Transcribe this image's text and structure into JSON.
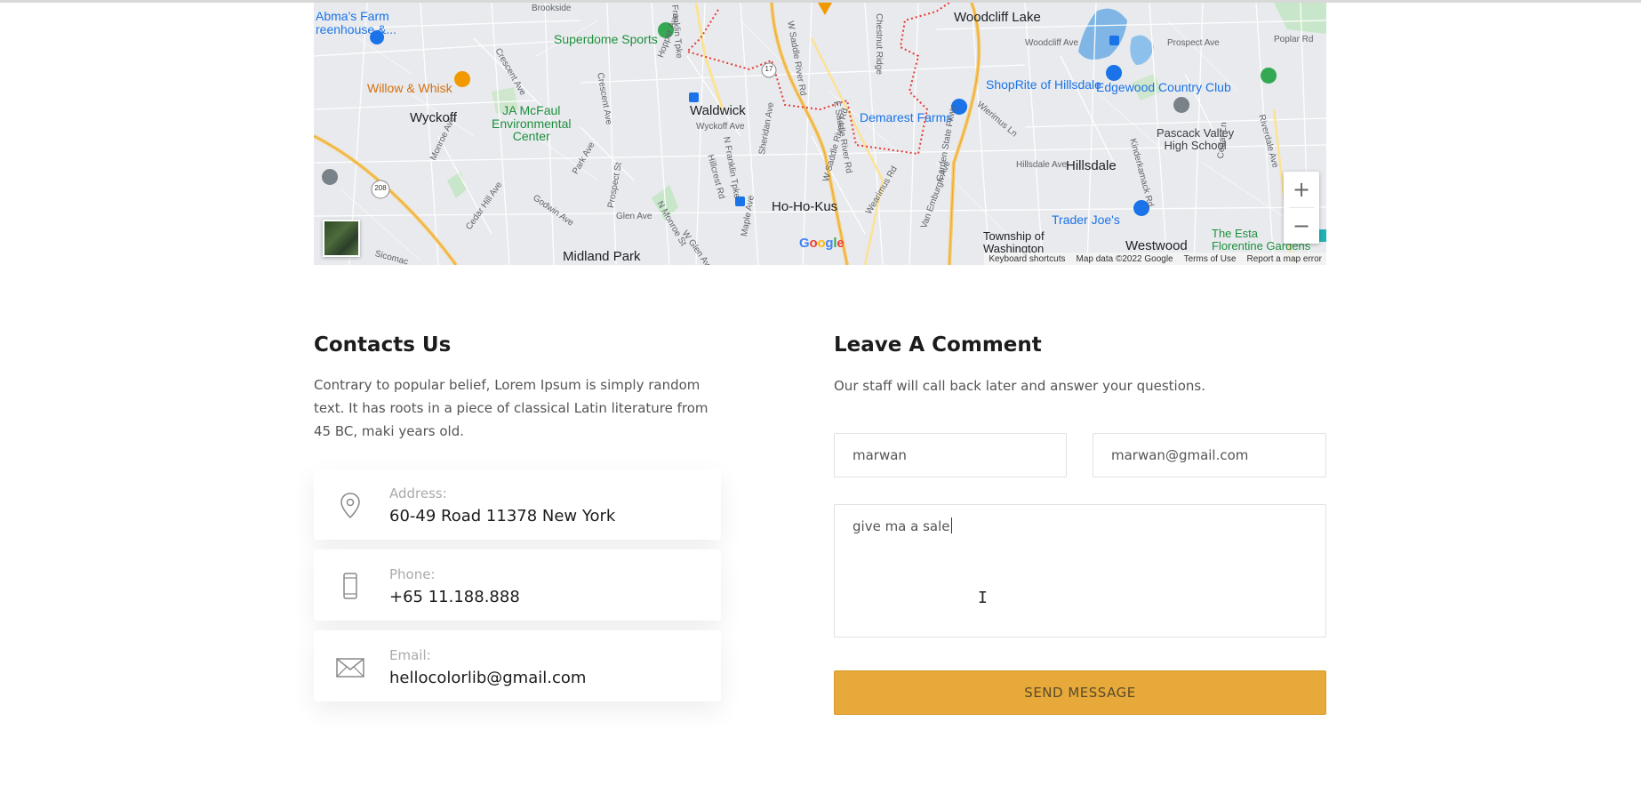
{
  "map": {
    "towns": [
      "Woodcliff Lake",
      "Waldwick",
      "Wyckoff",
      "Ho-Ho-Kus",
      "Hillsdale",
      "Midland Park",
      "Westwood",
      "Township of Washington"
    ],
    "pois": {
      "abmas": "Abma's Farm\nreenhouse &...",
      "superdome": "Superdome Sports",
      "willow": "Willow & Whisk",
      "jamcfaul": "JA McFaul\nEnvironmental\nCenter",
      "shoprite": "ShopRite of Hillsdale",
      "edgewood": "Edgewood Country Club",
      "pascack": "Pascack Valley\nHigh School",
      "demarest": "Demarest Farms",
      "traderjoes": "Trader Joe's",
      "estate": "The Esta\nFlorentine Gardens"
    },
    "streets": [
      "Brookside",
      "Crescent Ave",
      "Hopper Ave",
      "Crescent Ave",
      "Franklin Tpke",
      "W Saddle River Rd",
      "Chestnut Ridge",
      "Woodcliff Ave",
      "Prospect Ave",
      "Poplar Rd",
      "Wyckoff Ave",
      "Monroe Ave",
      "Park Ave",
      "Prospect St",
      "Hillcrest Rd",
      "N Franklin Tpke",
      "Sheridan Ave",
      "E Saddle River Rd",
      "Wierimus Ln",
      "Hillsdale Ave",
      "Kinderkamack Rd",
      "Cedar Ln",
      "Riverdale Ave",
      "Godwin Ave",
      "Glen Ave",
      "N Monroe St",
      "W Glen Ave",
      "Maple Ave",
      "W Saddle River Rd",
      "Wearimus Rd",
      "Van Emburgh Ave",
      "Garden State Pkwy",
      "Cedar Hill Ave",
      "Sicomac"
    ],
    "route_shields": [
      "17",
      "208"
    ],
    "zoom_in": "+",
    "zoom_out": "−",
    "google": [
      "G",
      "o",
      "o",
      "g",
      "l",
      "e"
    ],
    "footer": {
      "shortcuts": "Keyboard shortcuts",
      "data": "Map data ©2022 Google",
      "terms": "Terms of Use",
      "report": "Report a map error"
    }
  },
  "contacts": {
    "title": "Contacts Us",
    "description": "Contrary to popular belief, Lorem Ipsum is simply random text. It has roots in a piece of classical Latin literature from 45 BC, maki years old.",
    "items": [
      {
        "label": "Address:",
        "value": "60-49 Road 11378 New York",
        "icon": "location-pin-icon"
      },
      {
        "label": "Phone:",
        "value": "+65 11.188.888",
        "icon": "phone-icon"
      },
      {
        "label": "Email:",
        "value": "hellocolorlib@gmail.com",
        "icon": "envelope-icon"
      }
    ]
  },
  "comment": {
    "title": "Leave A Comment",
    "description": "Our staff will call back later and answer your questions.",
    "name_value": "marwan",
    "email_value": "marwan@gmail.com",
    "message_value": "give ma a sale",
    "button": "SEND MESSAGE"
  },
  "colors": {
    "accent": "#e6a93a",
    "heading": "#1c1c1c",
    "body_text": "#555555"
  }
}
